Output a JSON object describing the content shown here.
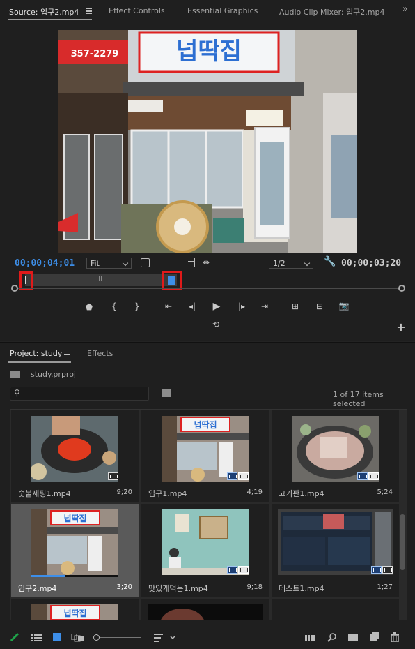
{
  "colors": {
    "accent_blue": "#3d8ee8",
    "green_pencil": "#1fa34a",
    "red_marker": "#e01a1a"
  },
  "source_panel": {
    "tabs": [
      {
        "label": "Source: 입구2.mp4",
        "active": true
      },
      {
        "label": "Effect Controls",
        "active": false
      },
      {
        "label": "Essential Graphics",
        "active": false
      },
      {
        "label": "Audio Clip Mixer: 입구2.mp4",
        "active": false
      }
    ],
    "overflow_icon": "chevron-double-right-icon",
    "sign_text": "넙딱집",
    "sign_phone": "357-2279",
    "timecode_current": "00;00;04;01",
    "zoom_select": "Fit",
    "resolution_select": "1/2",
    "timecode_duration": "00;00;03;20",
    "transport_icons": [
      "add-marker-icon",
      "mark-in-icon",
      "mark-out-icon",
      "go-to-in-icon",
      "step-back-icon",
      "play-icon",
      "step-forward-icon",
      "go-to-out-icon",
      "insert-icon",
      "overwrite-icon",
      "export-frame-icon"
    ]
  },
  "project_panel": {
    "tabs": [
      {
        "label": "Project: study",
        "active": true
      },
      {
        "label": "Effects",
        "active": false
      }
    ],
    "project_file": "study.prproj",
    "search_placeholder": "",
    "items_selected": "1 of 17 items selected",
    "items": [
      {
        "name": "숯불세팅1.mp4",
        "duration": "9;20",
        "selected": false
      },
      {
        "name": "입구1.mp4",
        "duration": "4;19",
        "selected": false
      },
      {
        "name": "고기판1.mp4",
        "duration": "5;24",
        "selected": false
      },
      {
        "name": "입구2.mp4",
        "duration": "3;20",
        "selected": true
      },
      {
        "name": "맛있게먹는1.mp4",
        "duration": "9;18",
        "selected": false
      },
      {
        "name": "테스트1.mp4",
        "duration": "1;27",
        "selected": false
      }
    ],
    "footer_icons": [
      "pencil-icon",
      "list-view-icon",
      "icon-view-icon",
      "freeform-view-icon",
      "zoom-slider",
      "sort-icon",
      "automate-icon",
      "find-icon",
      "new-bin-icon",
      "new-item-icon",
      "clear-icon"
    ]
  }
}
